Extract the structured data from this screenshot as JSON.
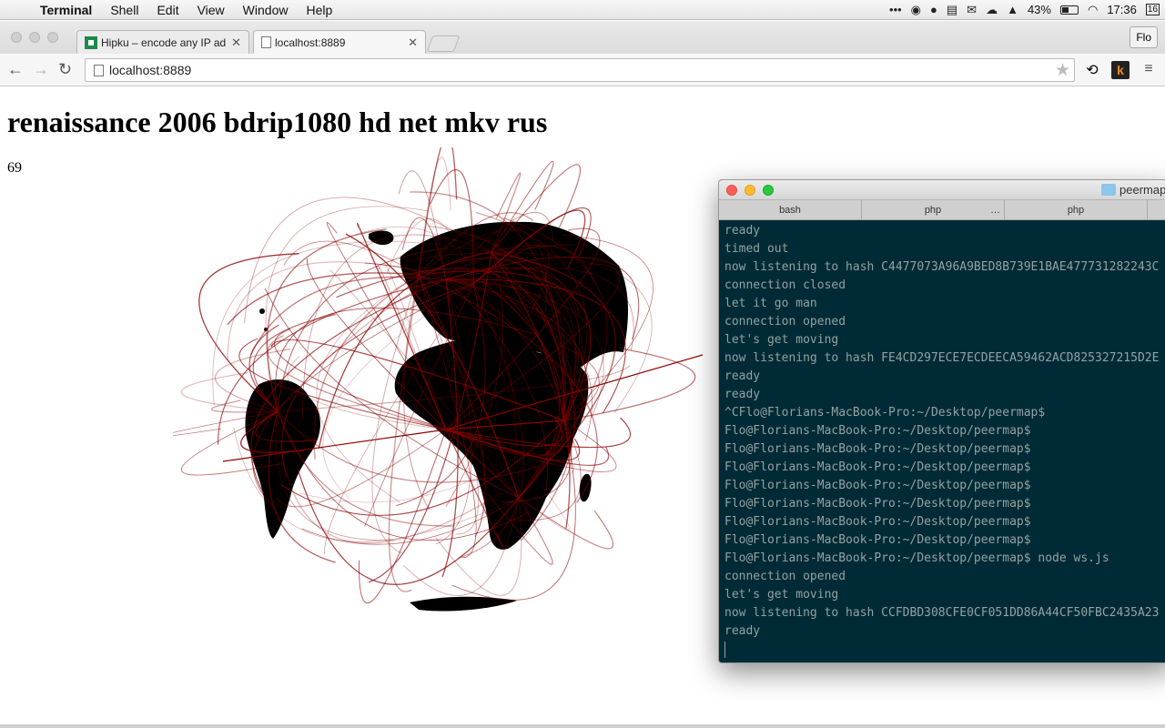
{
  "menubar": {
    "app": "Terminal",
    "items": [
      "Shell",
      "Edit",
      "View",
      "Window",
      "Help"
    ],
    "battery": "43%",
    "clock": "17:36",
    "calendar_day": "16"
  },
  "browser": {
    "tabs": [
      {
        "title": "Hipku – encode any IP add"
      },
      {
        "title": "localhost:8889"
      }
    ],
    "profile": "Flo",
    "url": "localhost:8889"
  },
  "page": {
    "title": "renaissance 2006 bdrip1080 hd net mkv rus",
    "peer_count": "69"
  },
  "terminal": {
    "window_title": "peermap",
    "tabs": [
      "bash",
      "php",
      "php"
    ],
    "lines": [
      "ready",
      "timed out",
      "now listening to hash C4477073A96A9BED8B739E1BAE477731282243C",
      "connection closed",
      "let it go man",
      "connection opened",
      "let's get moving",
      "now listening to hash FE4CD297ECE7ECDEECA59462ACD825327215D2E",
      "ready",
      "ready",
      "^CFlo@Florians-MacBook-Pro:~/Desktop/peermap$",
      "Flo@Florians-MacBook-Pro:~/Desktop/peermap$",
      "Flo@Florians-MacBook-Pro:~/Desktop/peermap$",
      "Flo@Florians-MacBook-Pro:~/Desktop/peermap$",
      "Flo@Florians-MacBook-Pro:~/Desktop/peermap$",
      "Flo@Florians-MacBook-Pro:~/Desktop/peermap$",
      "Flo@Florians-MacBook-Pro:~/Desktop/peermap$",
      "Flo@Florians-MacBook-Pro:~/Desktop/peermap$",
      "Flo@Florians-MacBook-Pro:~/Desktop/peermap$ node ws.js",
      "connection opened",
      "let's get moving",
      "now listening to hash CCFDBD308CFE0CF051DD86A44CF50FBC2435A23",
      "ready"
    ]
  },
  "colors": {
    "arc": "#8b0000",
    "terminal_bg": "#002b36",
    "terminal_fg": "#93a1a1"
  }
}
